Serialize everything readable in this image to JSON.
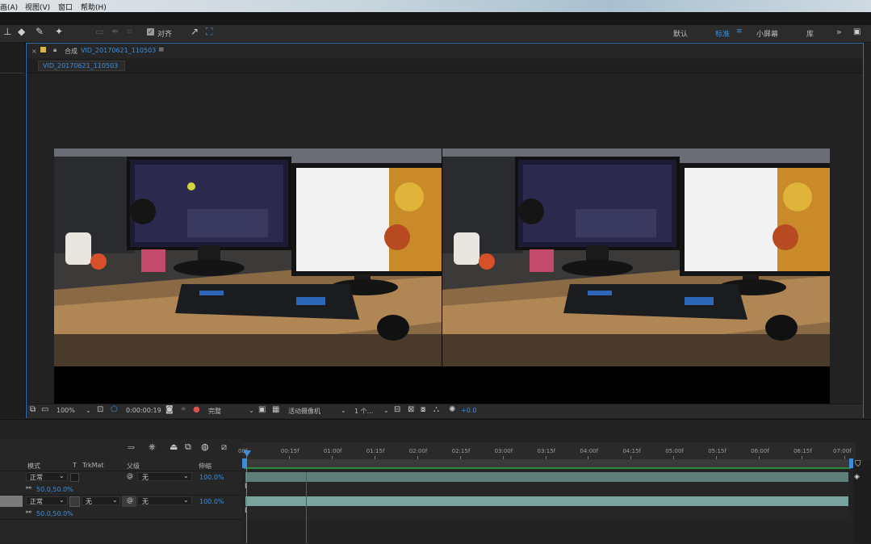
{
  "menu": {
    "items": [
      "画(A)",
      "视图(V)",
      "窗口",
      "帮助(H)"
    ]
  },
  "toolbar": {
    "snap_label": "对齐",
    "workspaces": [
      "默认",
      "标准",
      "小屏幕",
      "库"
    ],
    "active_workspace": "标准",
    "more": "»"
  },
  "comp": {
    "header_prefix": "合成",
    "comp_name": "VID_20170621_110503",
    "tab_label": "VID_20170621_110503",
    "menu_glyph": "≡"
  },
  "viewer_footer": {
    "zoom": "100%",
    "timecode": "0:00:00:19",
    "resolution": "完整",
    "camera": "活动摄像机",
    "views": "1 个...",
    "exposure": "+0.0"
  },
  "timeline": {
    "ruler_labels": [
      "00f",
      "00:15f",
      "01:00f",
      "01:15f",
      "02:00f",
      "02:15f",
      "03:00f",
      "03:15f",
      "04:00f",
      "04:15f",
      "05:00f",
      "05:15f",
      "06:00f",
      "06:15f",
      "07:00f"
    ],
    "columns": {
      "mode": "模式",
      "t": "T",
      "trkmat": "TrkMat",
      "parent": "父级",
      "stretch": "伸缩"
    },
    "layers": [
      {
        "mode": "正常",
        "trkmat": "",
        "parent": "无",
        "stretch": "100.0%",
        "scale": "50.0,50.0%"
      },
      {
        "mode": "正常",
        "trkmat": "无",
        "parent": "无",
        "stretch": "100.0%",
        "scale": "50.0,50.0%"
      }
    ]
  },
  "colors": {
    "accent": "#3d8ddc",
    "playhead": "#c0302b",
    "work_area": "#2c8a3c",
    "layer_bar": "#7aa39d"
  }
}
